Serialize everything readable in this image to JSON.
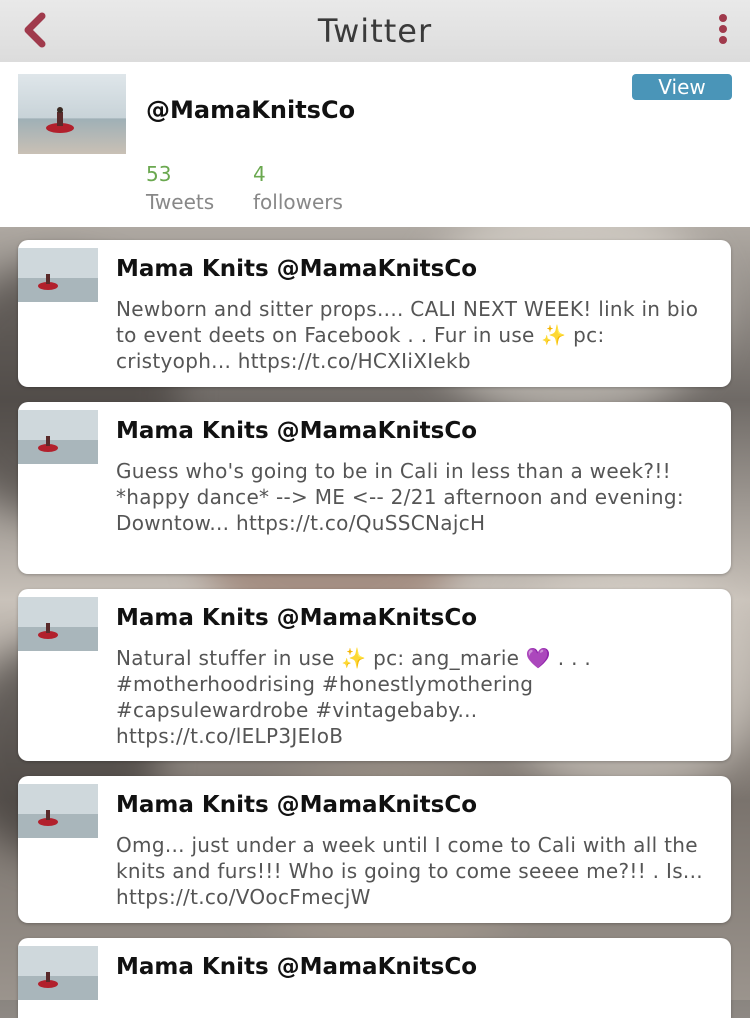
{
  "header": {
    "title": "Twitter"
  },
  "profile": {
    "handle": "@MamaKnitsCo",
    "view_label": "View",
    "tweets_count": "53",
    "tweets_label": "Tweets",
    "followers_count": "4",
    "followers_label": "followers"
  },
  "tweets": [
    {
      "author": "Mama Knits @MamaKnitsCo",
      "text": "Newborn and sitter props.... CALI NEXT WEEK! link in bio to event deets on Facebook . . Fur in use ✨ pc: cristyoph... https://t.co/HCXIiXIekb"
    },
    {
      "author": "Mama Knits @MamaKnitsCo",
      "text": "Guess who's going to be in Cali in less than a week?!! *happy dance* --> ME <-- 2/21 afternoon and evening: Downtow... https://t.co/QuSSCNajcH"
    },
    {
      "author": "Mama Knits @MamaKnitsCo",
      "text": "Natural stuffer in use ✨ pc: ang_marie 💜 . . . #motherhoodrising #honestlymothering #capsulewardrobe #vintagebaby... https://t.co/lELP3JEIoB"
    },
    {
      "author": "Mama Knits @MamaKnitsCo",
      "text": "Omg... just under a week until I come to Cali with all the knits and furs!!! Who is going to come seeee me?!! . Is... https://t.co/VOocFmecjW"
    },
    {
      "author": "Mama Knits @MamaKnitsCo",
      "text": ""
    }
  ],
  "icons": {
    "back": "chevron-left-icon",
    "menu": "more-vertical-icon"
  },
  "colors": {
    "accent_red": "#a03a4c",
    "view_button": "#4a95b8",
    "count_green": "#6aa84f"
  }
}
